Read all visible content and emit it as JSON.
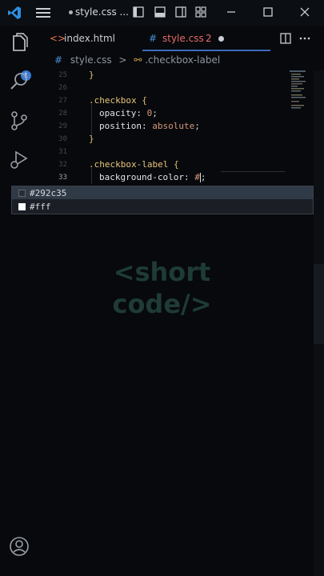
{
  "titlebar": {
    "title": "style.css ...",
    "icons": [
      "layout-sidebar-icon",
      "layout-panel-icon",
      "layout-sidebar-right-icon",
      "customize-layout-icon",
      "minimize-icon",
      "maximize-icon",
      "close-icon"
    ]
  },
  "activity": {
    "badge": "1"
  },
  "tabs": [
    {
      "label": "index.html",
      "icon": "<>"
    },
    {
      "label": "style.css",
      "icon": "#",
      "problems": "2"
    }
  ],
  "breadcrumb": {
    "file": "style.css",
    "separator": ">",
    "symbol": ".checkbox-label"
  },
  "editor": {
    "lines": [
      {
        "n": "25",
        "text": "}"
      },
      {
        "n": "26",
        "text": ""
      },
      {
        "n": "27",
        "selector": ".checkbox",
        "brace": "{"
      },
      {
        "n": "28",
        "prop": "opacity: ",
        "value": "0",
        "end": ";"
      },
      {
        "n": "29",
        "prop": "position: ",
        "value": "absolute",
        "end": ";"
      },
      {
        "n": "30",
        "text": "}"
      },
      {
        "n": "31",
        "text": ""
      },
      {
        "n": "32",
        "selector": ".checkbox-label",
        "brace": "{"
      },
      {
        "n": "33",
        "prop": "background-color: ",
        "value": "#",
        "end": ";"
      }
    ]
  },
  "suggestions": [
    {
      "label": "#292c35",
      "color": "#292c35"
    },
    {
      "label": "#fff",
      "color": "#ffffff"
    }
  ],
  "watermark": {
    "line1": "<short",
    "line2": "code/>"
  },
  "colors": {
    "accent": "#3c6cbf",
    "badge": "#3a7bd5",
    "html_icon": "#e8744f",
    "css_icon": "#4a8fd6",
    "css_tab_text": "#e86a6a"
  }
}
